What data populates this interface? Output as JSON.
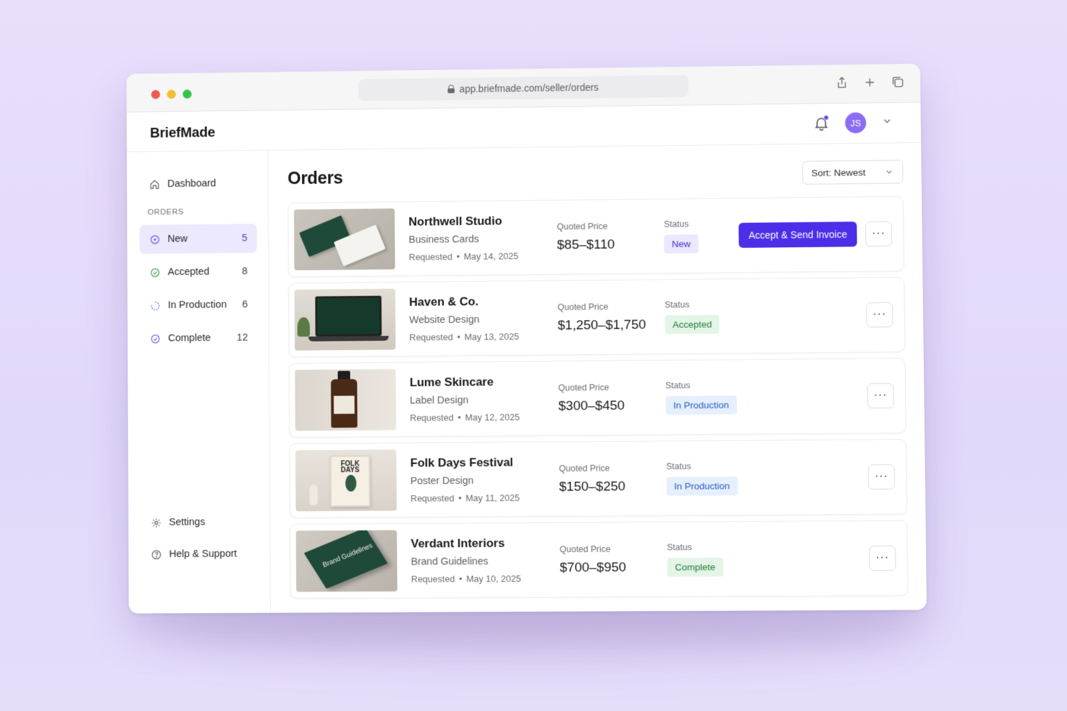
{
  "browser": {
    "url": "app.briefmade.com/seller/orders"
  },
  "app": {
    "brand": "BriefMade",
    "avatar_initials": "JS"
  },
  "sidebar": {
    "dashboard_label": "Dashboard",
    "section_label": "ORDERS",
    "items": [
      {
        "label": "New",
        "count": "5",
        "icon": "circle-dot-icon"
      },
      {
        "label": "Accepted",
        "count": "8",
        "icon": "check-circle-icon"
      },
      {
        "label": "In Production",
        "count": "6",
        "icon": "progress-circle-icon"
      },
      {
        "label": "Complete",
        "count": "12",
        "icon": "check-circle-icon"
      }
    ],
    "settings_label": "Settings",
    "help_label": "Help & Support"
  },
  "main": {
    "title": "Orders",
    "sort_label": "Sort: Newest",
    "price_label": "Quoted Price",
    "status_label": "Status",
    "requested_label": "Requested",
    "accept_button": "Accept & Send Invoice",
    "more_label": "···",
    "orders": [
      {
        "client": "Northwell Studio",
        "service": "Business Cards",
        "date": "May 14, 2025",
        "price": "$85–$110",
        "status": "New"
      },
      {
        "client": "Haven & Co.",
        "service": "Website Design",
        "date": "May 13, 2025",
        "price": "$1,250–$1,750",
        "status": "Accepted"
      },
      {
        "client": "Lume Skincare",
        "service": "Label Design",
        "date": "May 12, 2025",
        "price": "$300–$450",
        "status": "In Production"
      },
      {
        "client": "Folk Days Festival",
        "service": "Poster Design",
        "date": "May 11, 2025",
        "price": "$150–$250",
        "status": "In Production"
      },
      {
        "client": "Verdant Interiors",
        "service": "Brand Guidelines",
        "date": "May 10, 2025",
        "price": "$700–$950",
        "status": "Complete"
      }
    ]
  },
  "thumbnails": {
    "poster_text": "FOLK DAYS",
    "book_text": "Brand Guidelines"
  },
  "colors": {
    "accent": "#4c2ee8",
    "new_pill": "#ebe7fd",
    "accepted_pill": "#e4f5e7",
    "production_pill": "#e6f0fd"
  }
}
